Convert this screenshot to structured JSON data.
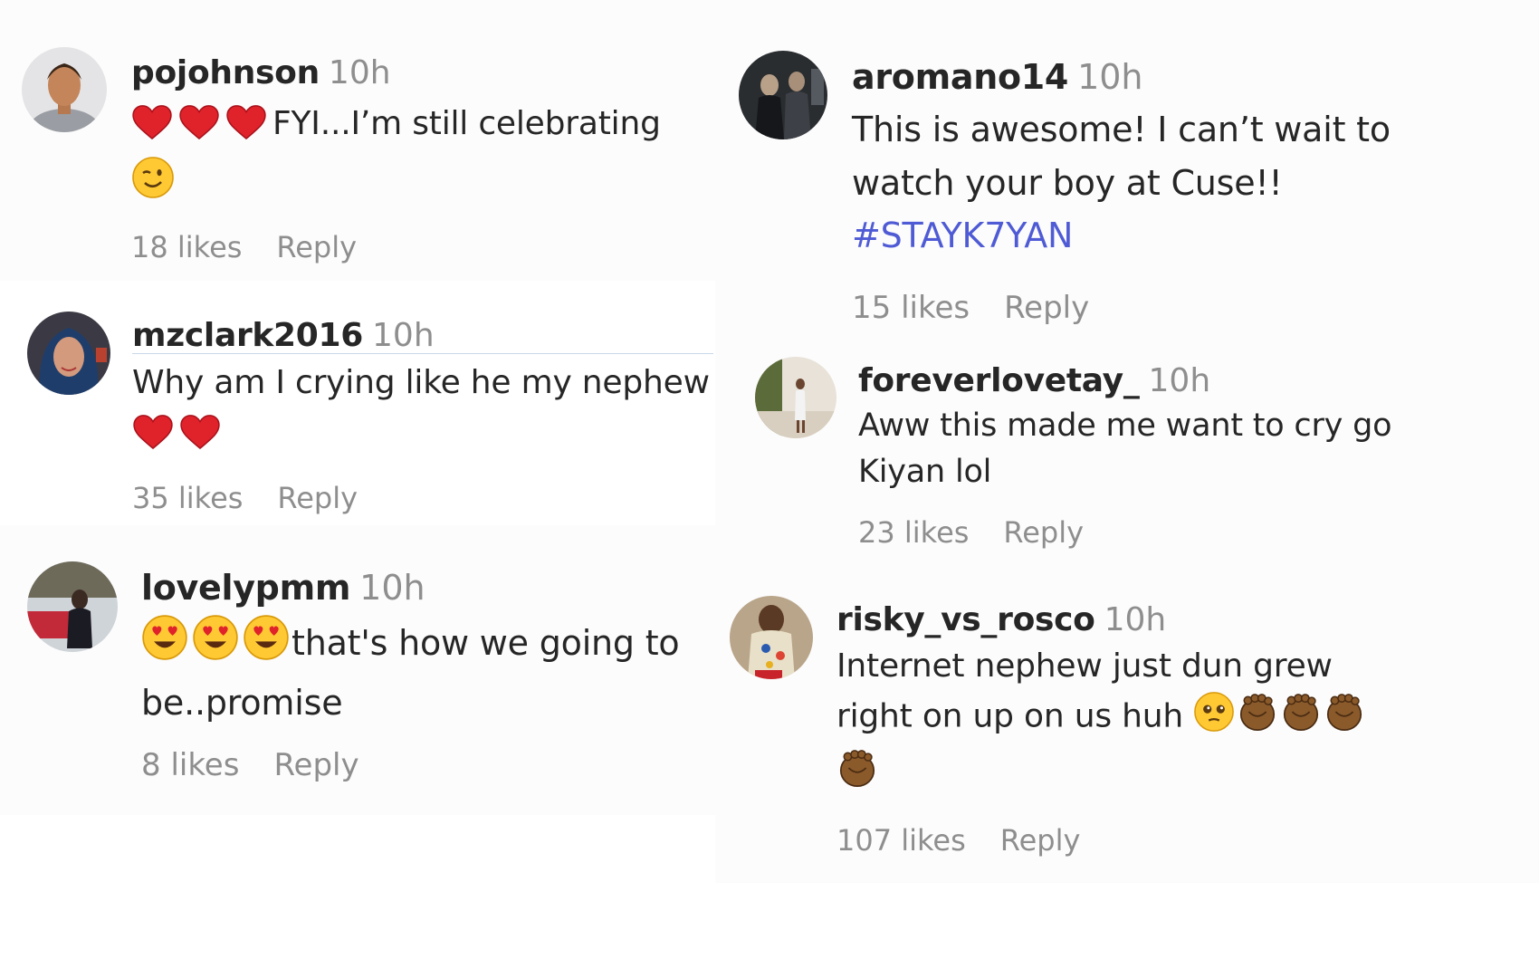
{
  "colors": {
    "username": "#262626",
    "secondary": "#8e8e8e",
    "hashtag": "#4f5bd5",
    "heart": "#e0222b",
    "face": "#ffc933",
    "hand": "#8b5a2b"
  },
  "comments": [
    {
      "username": "pojohnson",
      "time": "10h",
      "emoji_before": [
        "red-heart",
        "red-heart",
        "red-heart"
      ],
      "text": "FYI...I’m still celebrating",
      "emoji_after": [
        "winking-face"
      ],
      "likes": "18 likes",
      "reply": "Reply"
    },
    {
      "username": "mzclark2016",
      "time": "10h",
      "emoji_before": [],
      "text": "Why am I crying like he my nephew",
      "emoji_after": [
        "red-heart",
        "red-heart"
      ],
      "likes": "35 likes",
      "reply": "Reply"
    },
    {
      "username": "lovelypmm",
      "time": "10h",
      "emoji_before": [
        "heart-eyes-face",
        "heart-eyes-face",
        "heart-eyes-face"
      ],
      "text": "that's how we going to be..promise",
      "emoji_after": [],
      "likes": "8 likes",
      "reply": "Reply"
    },
    {
      "username": "aromano14",
      "time": "10h",
      "emoji_before": [],
      "text": "This is awesome! I can’t wait to watch your boy at Cuse!!",
      "hashtag": "#STAYK7YAN",
      "emoji_after": [],
      "likes": "15 likes",
      "reply": "Reply"
    },
    {
      "username": "foreverlovetay_",
      "time": "10h",
      "emoji_before": [],
      "text": "Aww this made me want to cry go Kiyan lol",
      "emoji_after": [],
      "likes": "23 likes",
      "reply": "Reply"
    },
    {
      "username": "risky_vs_rosco",
      "time": "10h",
      "emoji_before": [],
      "text": "Internet nephew just dun grew right on up on us huh",
      "emoji_after": [
        "pleading-face",
        "fist-dark",
        "fist-dark",
        "fist-dark",
        "fist-dark"
      ],
      "likes": "107 likes",
      "reply": "Reply"
    }
  ]
}
